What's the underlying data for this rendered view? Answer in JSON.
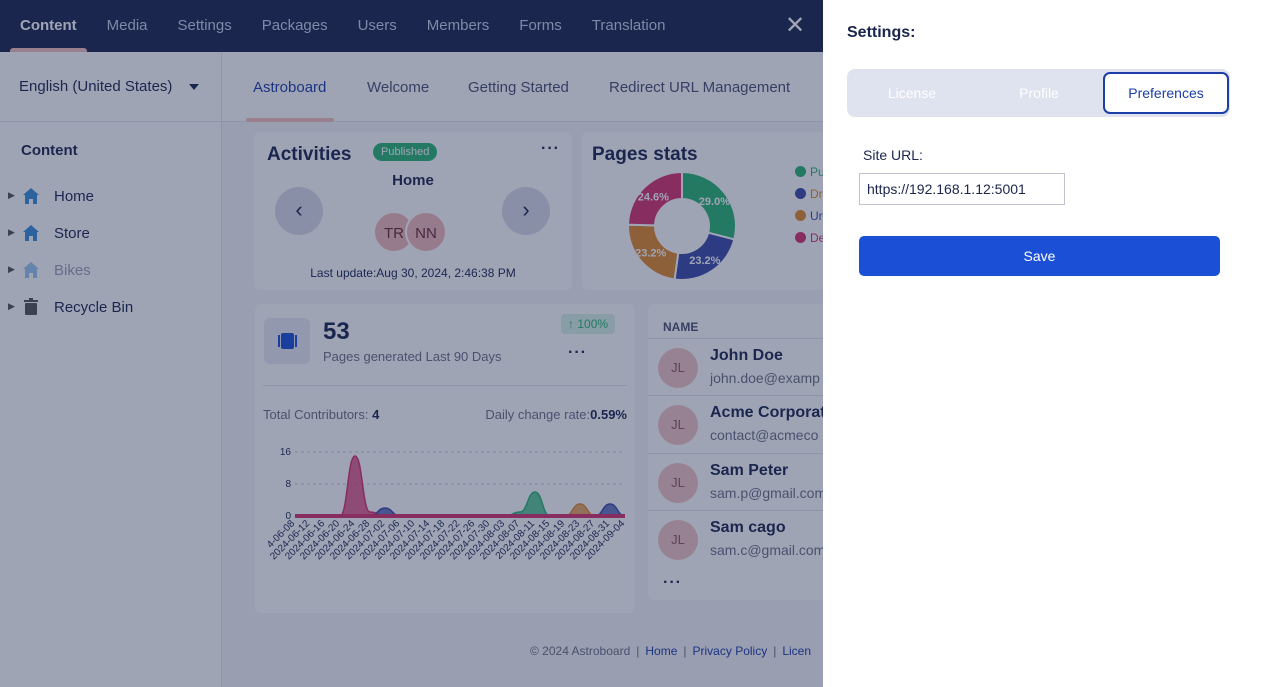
{
  "topnav": {
    "items": [
      "Content",
      "Media",
      "Settings",
      "Packages",
      "Users",
      "Members",
      "Forms",
      "Translation"
    ],
    "active": "Content"
  },
  "sidebar": {
    "language": "English (United States)",
    "tree_title": "Content",
    "items": [
      {
        "label": "Home",
        "icon": "home-icon"
      },
      {
        "label": "Store",
        "icon": "home-icon"
      },
      {
        "label": "Bikes",
        "icon": "home-icon",
        "faded": true
      },
      {
        "label": "Recycle Bin",
        "icon": "trash-icon"
      }
    ]
  },
  "subtabs": [
    "Astroboard",
    "Welcome",
    "Getting Started",
    "Redirect URL Management"
  ],
  "activities": {
    "title": "Activities",
    "badge": "Published",
    "menu": "···",
    "page": "Home",
    "prev": "‹",
    "next": "›",
    "avatars": [
      "TR",
      "NN"
    ],
    "last_update": "Last update:Aug 30, 2024, 2:46:38 PM"
  },
  "pages_stats": {
    "title": "Pages stats",
    "slice_labels": [
      "29.0%",
      "23.2%",
      "23.2%",
      "24.6%"
    ],
    "legend": [
      "Pu",
      "Dr",
      "Ur",
      "De"
    ],
    "colors": [
      "#2bb673",
      "#3b4ba8",
      "#e08a2b",
      "#d6336c"
    ]
  },
  "generated": {
    "count": "53",
    "subtitle": "Pages generated Last 90 Days",
    "change": "100%",
    "menu": "···",
    "contributors_label": "Total Contributors:",
    "contributors_value": "4",
    "rate_label": "Daily change rate:",
    "rate_value": "0.59%"
  },
  "chart_data": {
    "type": "area",
    "yticks": [
      "16",
      "8",
      "0"
    ],
    "ylim": [
      0,
      16
    ],
    "x": [
      "2024-06-08",
      "2024-06-12",
      "2024-06-16",
      "2024-06-20",
      "2024-06-24",
      "2024-06-28",
      "2024-07-02",
      "2024-07-06",
      "2024-07-10",
      "2024-07-14",
      "2024-07-18",
      "2024-07-22",
      "2024-07-26",
      "2024-07-30",
      "2024-08-03",
      "2024-08-07",
      "2024-08-11",
      "2024-08-15",
      "2024-08-19",
      "2024-08-23",
      "2024-08-27",
      "2024-08-31",
      "2024-09-04"
    ],
    "x_tick_labels": [
      "4-06-08",
      "2024-06-12",
      "2024-06-16",
      "2024-06-20",
      "2024-06-24",
      "2024-06-28",
      "2024-07-02",
      "2024-07-06",
      "2024-07-10",
      "2024-07-14",
      "2024-07-18",
      "2024-07-22",
      "2024-07-26",
      "2024-07-30",
      "2024-08-03",
      "2024-08-07",
      "2024-08-11",
      "2024-08-15",
      "2024-08-19",
      "2024-08-23",
      "2024-08-27",
      "2024-08-31",
      "2024-09-04"
    ],
    "series": [
      {
        "color": "#d6336c",
        "values": [
          0,
          0,
          0,
          0,
          15,
          1,
          0,
          0,
          0,
          0,
          0,
          0,
          0,
          0,
          0,
          0,
          0,
          0,
          0,
          0,
          0,
          0,
          0
        ]
      },
      {
        "color": "#3b4ba8",
        "values": [
          0,
          0,
          0,
          0,
          0,
          0,
          2,
          0,
          0,
          0,
          0,
          0,
          0,
          0,
          0,
          0,
          0,
          0,
          0,
          0,
          0,
          3,
          0
        ]
      },
      {
        "color": "#2bb673",
        "values": [
          0,
          0,
          0,
          0,
          0,
          0,
          0,
          0,
          0,
          0,
          0,
          0,
          0,
          0,
          0,
          1,
          6,
          0,
          0,
          0,
          0,
          0,
          0
        ]
      },
      {
        "color": "#e08a2b",
        "values": [
          0,
          0,
          0,
          0,
          0,
          0,
          0,
          0,
          0,
          0,
          0,
          0,
          0,
          0,
          0,
          0,
          0,
          0,
          0,
          3,
          0,
          0,
          0
        ]
      }
    ]
  },
  "people": {
    "header": "NAME",
    "rows": [
      {
        "initials": "JL",
        "name": "John Doe",
        "email": "john.doe@examp"
      },
      {
        "initials": "JL",
        "name": "Acme Corporati",
        "email": "contact@acmeco"
      },
      {
        "initials": "JL",
        "name": "Sam Peter",
        "email": "sam.p@gmail.com"
      },
      {
        "initials": "JL",
        "name": "Sam cago",
        "email": "sam.c@gmail.com"
      }
    ],
    "more": "···"
  },
  "footer": {
    "copyright": "© 2024 Astroboard",
    "sep": "|",
    "links": [
      "Home",
      "Privacy Policy",
      "Licen"
    ]
  },
  "settings": {
    "title": "Settings:",
    "tabs": [
      "License",
      "Profile",
      "Preferences"
    ],
    "active_tab": "Preferences",
    "site_url_label": "Site URL:",
    "site_url_value": "https://192.168.1.12:5001",
    "save_label": "Save",
    "close": "✕"
  }
}
